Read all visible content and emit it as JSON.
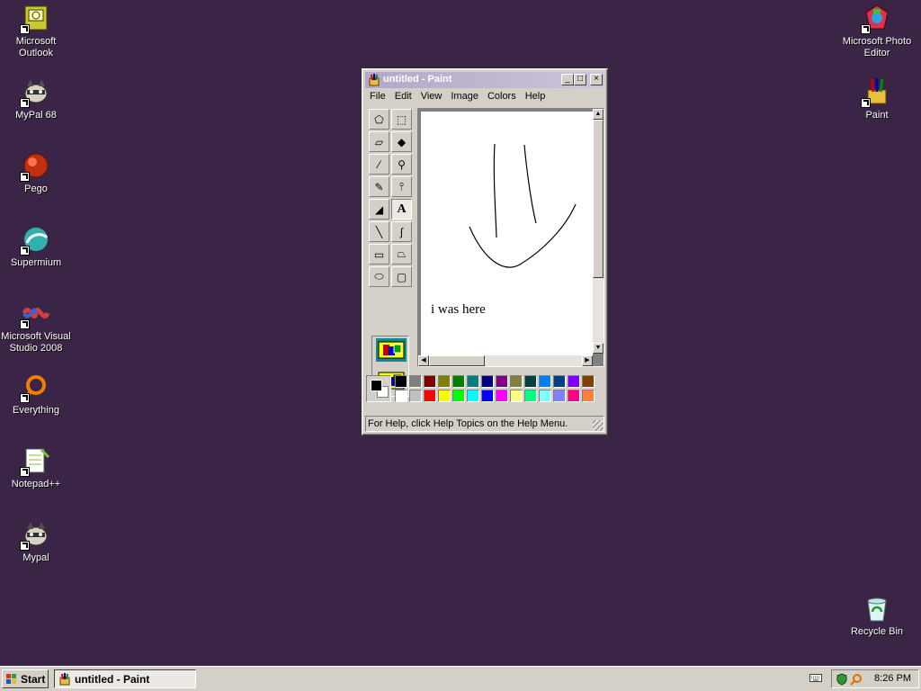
{
  "desktop": {
    "icons_left": [
      {
        "label": "Microsoft Outlook",
        "icon": "outlook-icon"
      },
      {
        "label": "MyPal 68",
        "icon": "raccoon-icon"
      },
      {
        "label": "Pego",
        "icon": "pego-icon"
      },
      {
        "label": "Supermium",
        "icon": "supermium-icon"
      },
      {
        "label": "Microsoft Visual Studio 2008",
        "icon": "visual-studio-icon"
      },
      {
        "label": "Everything",
        "icon": "everything-icon"
      },
      {
        "label": "Notepad++",
        "icon": "notepad-plus-plus-icon"
      },
      {
        "label": "Mypal",
        "icon": "raccoon-icon"
      }
    ],
    "icons_right": [
      {
        "label": "Microsoft Photo Editor",
        "icon": "photo-editor-icon"
      },
      {
        "label": "Paint",
        "icon": "paint-icon"
      },
      {
        "label": "Recycle Bin",
        "icon": "recycle-bin-icon"
      }
    ]
  },
  "window": {
    "title": "untitled - Paint",
    "controls": {
      "minimize": "_",
      "maximize": "□",
      "close": "×"
    },
    "menu": [
      "File",
      "Edit",
      "View",
      "Image",
      "Colors",
      "Help"
    ],
    "tools": [
      {
        "name": "free-form-select-tool",
        "glyph": "⬠"
      },
      {
        "name": "select-tool",
        "glyph": "⬚"
      },
      {
        "name": "eraser-tool",
        "glyph": "▱"
      },
      {
        "name": "fill-tool",
        "glyph": "◆"
      },
      {
        "name": "pick-color-tool",
        "glyph": "⁄"
      },
      {
        "name": "magnifier-tool",
        "glyph": "⚲"
      },
      {
        "name": "pencil-tool",
        "glyph": "✎"
      },
      {
        "name": "brush-tool",
        "glyph": "⫯"
      },
      {
        "name": "airbrush-tool",
        "glyph": "◢"
      },
      {
        "name": "text-tool",
        "glyph": "A"
      },
      {
        "name": "line-tool",
        "glyph": "╲"
      },
      {
        "name": "curve-tool",
        "glyph": "∫"
      },
      {
        "name": "rectangle-tool",
        "glyph": "▭"
      },
      {
        "name": "polygon-tool",
        "glyph": "⏢"
      },
      {
        "name": "ellipse-tool",
        "glyph": "⬭"
      },
      {
        "name": "rounded-rectangle-tool",
        "glyph": "▢"
      }
    ],
    "active_tool": "text-tool",
    "canvas_text": "i was here",
    "palette": {
      "foreground": "#000000",
      "background": "#ffffff",
      "top_row": [
        "#000000",
        "#808080",
        "#800000",
        "#808000",
        "#008000",
        "#008080",
        "#000080",
        "#800080",
        "#808040",
        "#004040",
        "#0080ff",
        "#004080",
        "#8000ff",
        "#804000"
      ],
      "bottom_row": [
        "#ffffff",
        "#c0c0c0",
        "#ff0000",
        "#ffff00",
        "#00ff00",
        "#00ffff",
        "#0000ff",
        "#ff00ff",
        "#ffff80",
        "#00ff80",
        "#80ffff",
        "#8080ff",
        "#ff0080",
        "#ff8040"
      ]
    },
    "status": "For Help, click Help Topics on the Help Menu."
  },
  "taskbar": {
    "start_label": "Start",
    "task_label": "untitled - Paint",
    "clock": "8:26 PM"
  }
}
